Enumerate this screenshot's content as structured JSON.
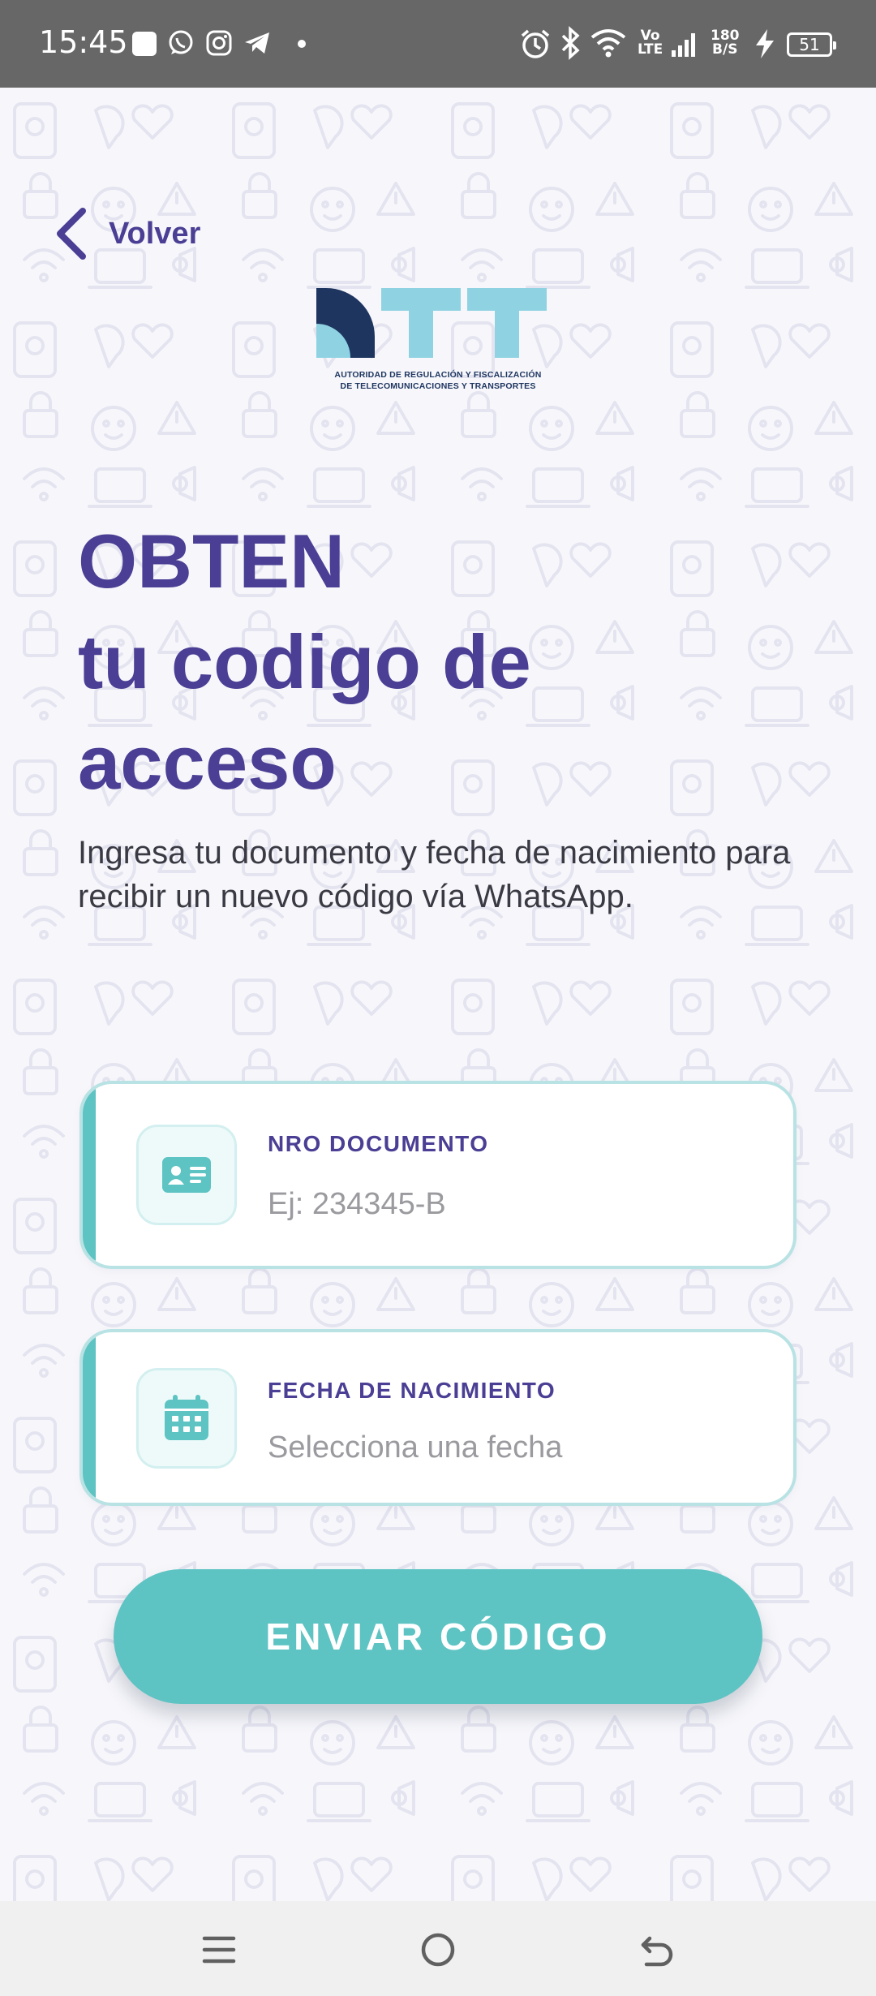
{
  "status_bar": {
    "time": "15:45",
    "volte_top": "Vo",
    "volte_bottom": "LTE",
    "speed_top": "180",
    "speed_bottom": "B/S",
    "battery": "51"
  },
  "header": {
    "back_label": "Volver"
  },
  "logo": {
    "caption_line1": "AUTORIDAD DE REGULACIÓN Y FISCALIZACIÓN",
    "caption_line2": "DE TELECOMUNICACIONES Y TRANSPORTES"
  },
  "main": {
    "title_line1": "OBTEN",
    "title_line2": "tu codigo de",
    "title_line3": "acceso",
    "subtitle": "Ingresa tu documento y fecha de nacimiento para recibir un nuevo código vía WhatsApp."
  },
  "form": {
    "document": {
      "label": "NRO DOCUMENTO",
      "placeholder": "Ej: 234345-B",
      "value": ""
    },
    "birthdate": {
      "label": "FECHA DE NACIMIENTO",
      "placeholder": "Selecciona una fecha",
      "value": ""
    },
    "submit_label": "ENVIAR CÓDIGO"
  },
  "colors": {
    "primary": "#4a3f94",
    "accent": "#5ec3c3",
    "status_bar": "#676767",
    "logo_dark": "#1e3560",
    "logo_light": "#8fd3e3"
  }
}
